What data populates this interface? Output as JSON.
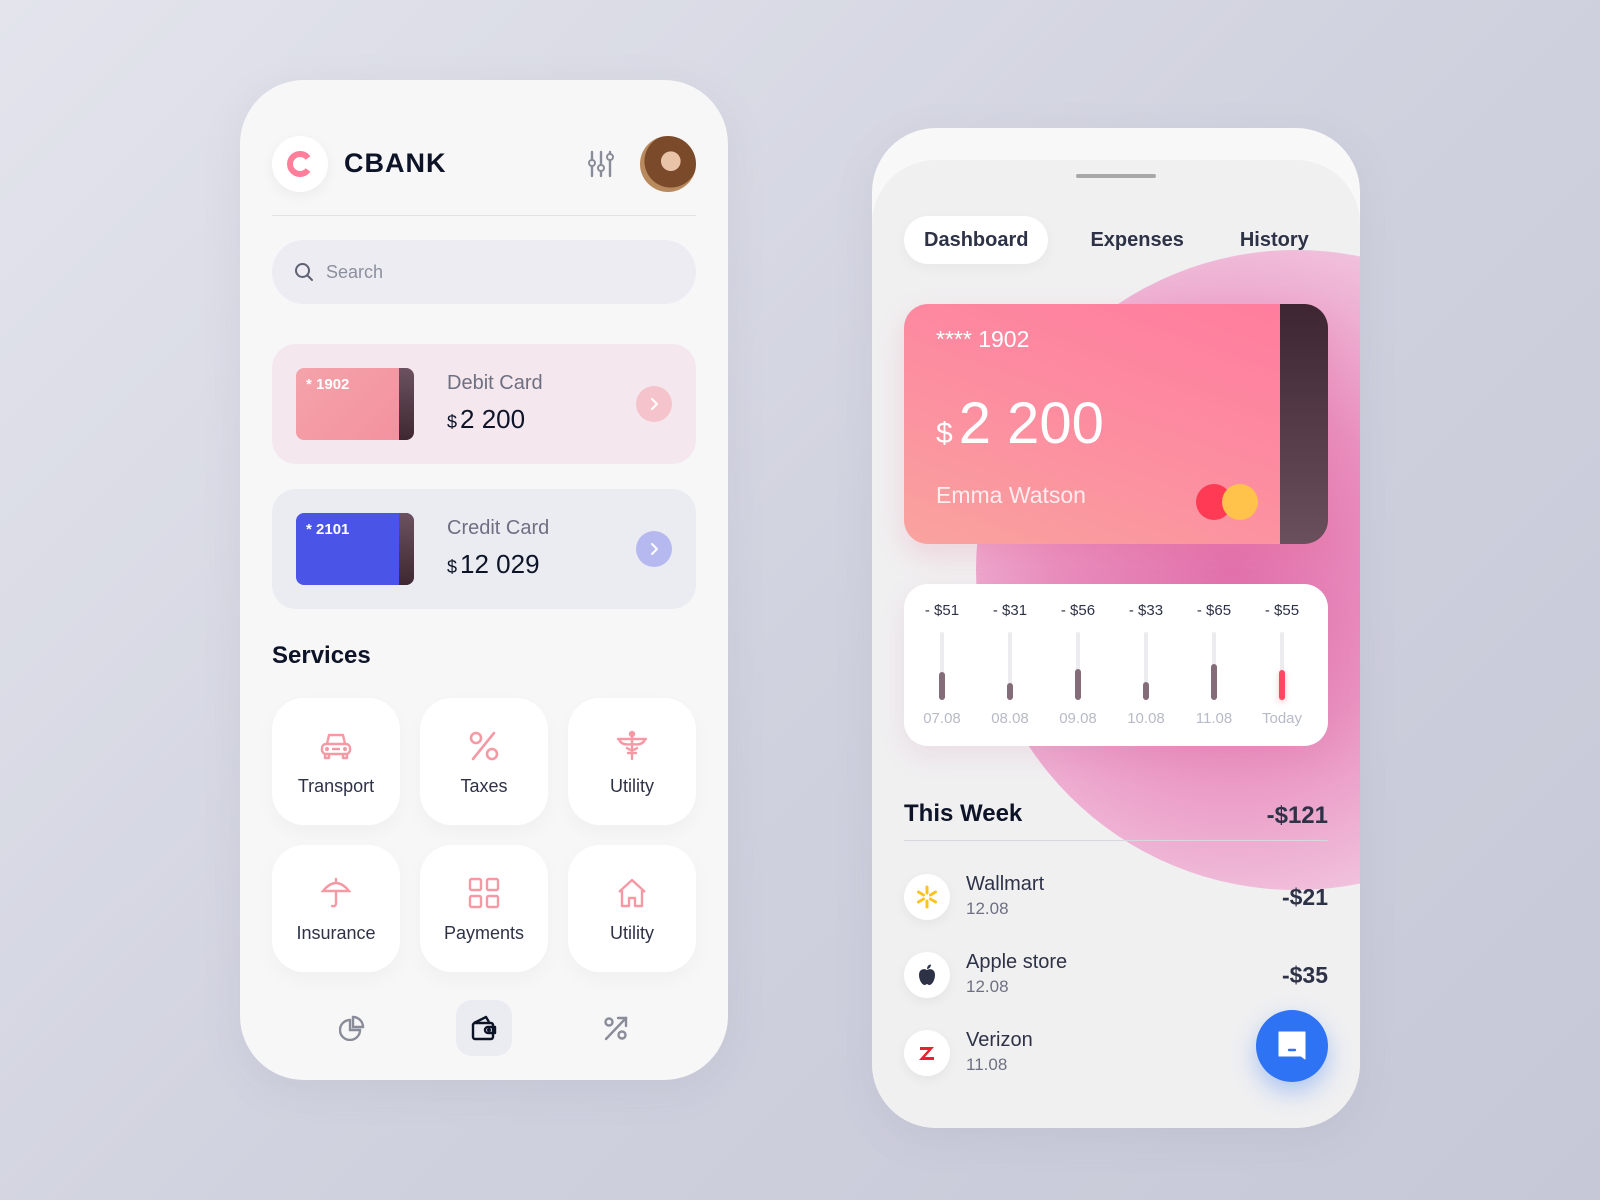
{
  "left_app": {
    "brand": {
      "logo_letter": "C",
      "name": "CBANK"
    },
    "header": {
      "filter_icon": "sliders-icon",
      "avatar_alt": "user-avatar"
    },
    "search": {
      "placeholder": "Search",
      "value": ""
    },
    "accounts": [
      {
        "card_number": "* 1902",
        "label": "Debit Card",
        "currency": "$",
        "amount": "2 200",
        "color": "#f49aa5"
      },
      {
        "card_number": "* 2101",
        "label": "Credit Card",
        "currency": "$",
        "amount": "12 029",
        "color": "#4a55e8"
      }
    ],
    "services_title": "Services",
    "services": [
      {
        "label": "Transport",
        "icon": "car-icon"
      },
      {
        "label": "Taxes",
        "icon": "percent-icon"
      },
      {
        "label": "Utility",
        "icon": "caduceus-icon"
      },
      {
        "label": "Insurance",
        "icon": "umbrella-icon"
      },
      {
        "label": "Payments",
        "icon": "grid-icon"
      },
      {
        "label": "Utility",
        "icon": "home-icon"
      }
    ],
    "bottom_nav": [
      {
        "icon": "pie-chart-icon",
        "active": false
      },
      {
        "icon": "wallet-icon",
        "active": true
      },
      {
        "icon": "percent-arrow-icon",
        "active": false
      }
    ]
  },
  "right_app": {
    "tabs": [
      {
        "label": "Dashboard",
        "active": true
      },
      {
        "label": "Expenses",
        "active": false
      },
      {
        "label": "History",
        "active": false
      }
    ],
    "card": {
      "number": "**** 1902",
      "currency": "$",
      "balance": "2 200",
      "holder": "Emma Watson",
      "network_icon": "mastercard-icon"
    },
    "daily_spend": {
      "max_value": 80,
      "days": [
        {
          "value_label": "- $51",
          "value": 51,
          "date": "07.08",
          "today": false
        },
        {
          "value_label": "- $31",
          "value": 31,
          "date": "08.08",
          "today": false
        },
        {
          "value_label": "- $56",
          "value": 56,
          "date": "09.08",
          "today": false
        },
        {
          "value_label": "- $33",
          "value": 33,
          "date": "10.08",
          "today": false
        },
        {
          "value_label": "- $65",
          "value": 65,
          "date": "11.08",
          "today": false
        },
        {
          "value_label": "- $55",
          "value": 55,
          "date": "Today",
          "today": true
        }
      ]
    },
    "this_week": {
      "title": "This Week",
      "total": "-$121",
      "transactions": [
        {
          "name": "Wallmart",
          "date": "12.08",
          "amount": "-$21",
          "icon": "walmart-spark-icon"
        },
        {
          "name": "Apple store",
          "date": "12.08",
          "amount": "-$35",
          "icon": "apple-icon"
        },
        {
          "name": "Verizon",
          "date": "11.08",
          "amount": "",
          "icon": "verizon-icon"
        }
      ]
    },
    "fab": {
      "icon": "chat-icon"
    }
  }
}
